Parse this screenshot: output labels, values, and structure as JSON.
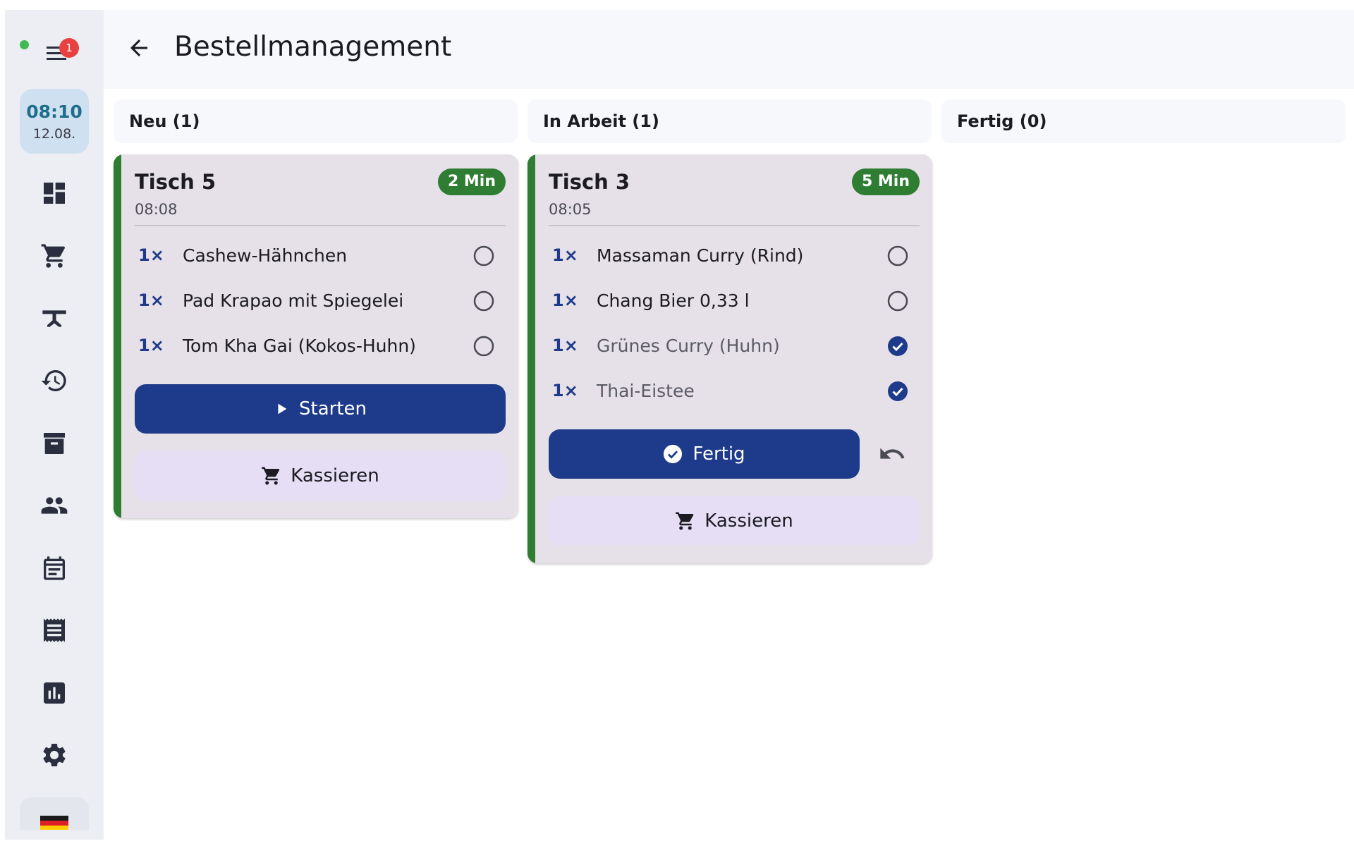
{
  "app": {
    "title": "Bestellmanagement",
    "notification_count": "1",
    "clock": {
      "time": "08:10",
      "date": "12.08."
    }
  },
  "sidebar": {
    "icons": [
      "dashboard-icon",
      "cart-icon",
      "table-icon",
      "history-icon",
      "archive-icon",
      "people-icon",
      "calendar-icon",
      "receipt-icon",
      "chart-icon",
      "settings-icon"
    ]
  },
  "columns": [
    {
      "label": "Neu (1)"
    },
    {
      "label": "In Arbeit (1)"
    },
    {
      "label": "Fertig (0)"
    }
  ],
  "orders": [
    {
      "table": "Tisch 5",
      "time": "08:08",
      "age": "2 Min",
      "items": [
        {
          "qty": "1×",
          "name": "Cashew-Hähnchen",
          "done": false
        },
        {
          "qty": "1×",
          "name": "Pad Krapao mit Spiegelei",
          "done": false
        },
        {
          "qty": "1×",
          "name": "Tom Kha Gai (Kokos-Huhn)",
          "done": false
        }
      ],
      "primary_action": "Starten",
      "secondary_action": "Kassieren"
    },
    {
      "table": "Tisch 3",
      "time": "08:05",
      "age": "5 Min",
      "items": [
        {
          "qty": "1×",
          "name": "Massaman Curry (Rind)",
          "done": false
        },
        {
          "qty": "1×",
          "name": "Chang Bier 0,33 l",
          "done": false
        },
        {
          "qty": "1×",
          "name": "Grünes Curry (Huhn)",
          "done": true
        },
        {
          "qty": "1×",
          "name": "Thai-Eistee",
          "done": true
        }
      ],
      "primary_action": "Fertig",
      "secondary_action": "Kassieren"
    }
  ],
  "colors": {
    "accent": "#1e3a8a",
    "status_green": "#2e7d32",
    "notification_red": "#e94040"
  }
}
